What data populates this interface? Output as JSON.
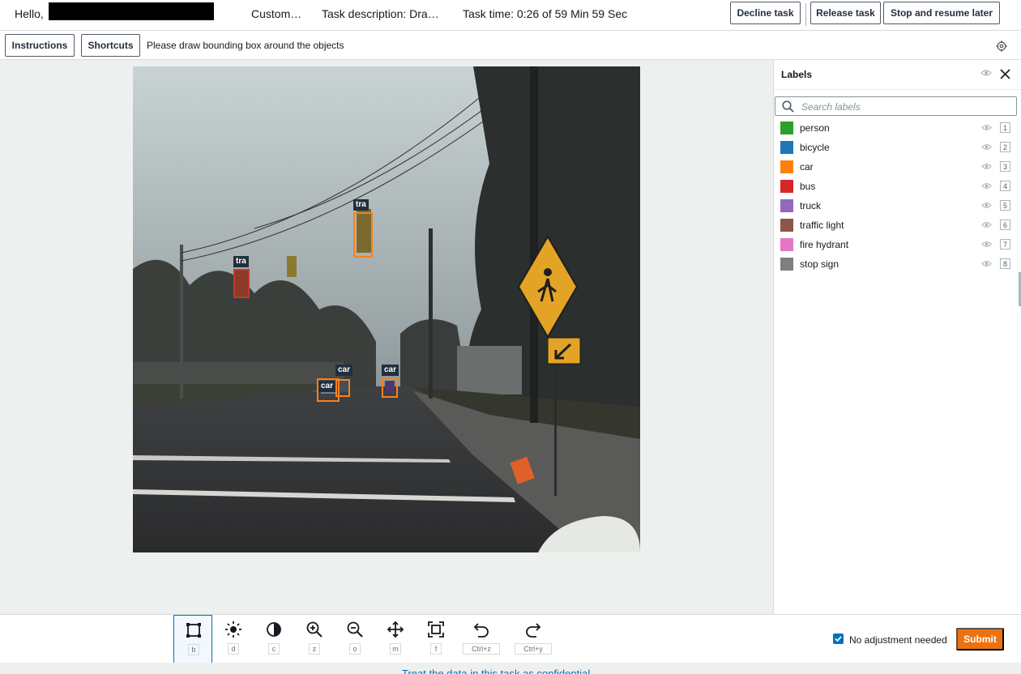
{
  "header": {
    "greeting": "Hello,",
    "task_title": "Custom…",
    "task_description": "Task description: Dra…",
    "task_time": "Task time: 0:26 of 59 Min 59 Sec",
    "decline_label": "Decline task",
    "release_label": "Release task",
    "stop_label": "Stop and resume later"
  },
  "instructions_bar": {
    "instructions_label": "Instructions",
    "shortcuts_label": "Shortcuts",
    "text": "Please draw bounding box around the objects"
  },
  "canvas": {
    "annotations": [
      {
        "tag": "tra"
      },
      {
        "tag": "tra"
      },
      {
        "tag": "car"
      },
      {
        "tag": "car"
      },
      {
        "tag": "car"
      }
    ]
  },
  "labels_panel": {
    "title": "Labels",
    "search_placeholder": "Search labels",
    "labels": [
      {
        "name": "person",
        "color": "#2ca02c",
        "key": "1"
      },
      {
        "name": "bicycle",
        "color": "#1f77b4",
        "key": "2"
      },
      {
        "name": "car",
        "color": "#ff7f0e",
        "key": "3"
      },
      {
        "name": "bus",
        "color": "#d62728",
        "key": "4"
      },
      {
        "name": "truck",
        "color": "#9467bd",
        "key": "5"
      },
      {
        "name": "traffic light",
        "color": "#8c564b",
        "key": "6"
      },
      {
        "name": "fire hydrant",
        "color": "#e377c2",
        "key": "7"
      },
      {
        "name": "stop sign",
        "color": "#7f7f7f",
        "key": "8"
      }
    ]
  },
  "toolbar": {
    "tools": [
      {
        "icon": "bounding-box-icon",
        "key": "b"
      },
      {
        "icon": "brightness-icon",
        "key": "d"
      },
      {
        "icon": "contrast-icon",
        "key": "c"
      },
      {
        "icon": "zoom-in-icon",
        "key": "z"
      },
      {
        "icon": "zoom-out-icon",
        "key": "o"
      },
      {
        "icon": "move-icon",
        "key": "m"
      },
      {
        "icon": "fit-screen-icon",
        "key": "f"
      },
      {
        "icon": "undo-icon",
        "key": "Ctrl+z"
      },
      {
        "icon": "redo-icon",
        "key": "Ctrl+y"
      }
    ],
    "no_adjustment_label": "No adjustment needed",
    "submit_label": "Submit"
  },
  "footer": {
    "text": "Treat the data in this task as confidential"
  },
  "colors": {
    "accent": "#ec7211",
    "link": "#0073bb",
    "bbox": "#f58220"
  }
}
